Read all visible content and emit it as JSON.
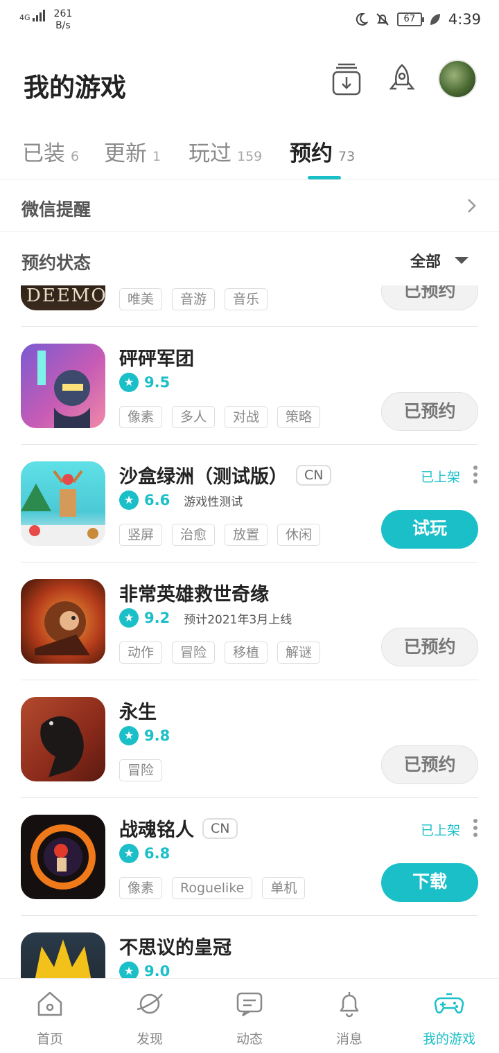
{
  "status_bar": {
    "network": "4G",
    "speed_value": "261",
    "speed_unit": "B/s",
    "battery": "67",
    "time": "4:39"
  },
  "header": {
    "title": "我的游戏"
  },
  "tabs": [
    {
      "label": "已装",
      "count": "6"
    },
    {
      "label": "更新",
      "count": "1"
    },
    {
      "label": "玩过",
      "count": "159"
    },
    {
      "label": "预约",
      "count": "73"
    }
  ],
  "wechat_reminder": {
    "label": "微信提醒"
  },
  "reservation_status": {
    "label": "预约状态",
    "filter": "全部"
  },
  "games": [
    {
      "name": "",
      "tags": [
        "唯美",
        "音游",
        "音乐"
      ],
      "button": "已预约",
      "icon_text": "DEEMO"
    },
    {
      "name": "砰砰军团",
      "rating": "9.5",
      "tags": [
        "像素",
        "多人",
        "对战",
        "策略"
      ],
      "button": "已预约"
    },
    {
      "name": "沙盒绿洲（测试版）",
      "badge": "CN",
      "rating": "6.6",
      "status": "游戏性测试",
      "launched": "已上架",
      "tags": [
        "竖屏",
        "治愈",
        "放置",
        "休闲"
      ],
      "button": "试玩"
    },
    {
      "name": "非常英雄救世奇缘",
      "rating": "9.2",
      "status": "预计2021年3月上线",
      "tags": [
        "动作",
        "冒险",
        "移植",
        "解谜"
      ],
      "button": "已预约"
    },
    {
      "name": "永生",
      "rating": "9.8",
      "tags": [
        "冒险"
      ],
      "button": "已预约"
    },
    {
      "name": "战魂铭人",
      "badge": "CN",
      "rating": "6.8",
      "launched": "已上架",
      "tags": [
        "像素",
        "Roguelike",
        "单机"
      ],
      "button": "下载"
    },
    {
      "name": "不思议的皇冠",
      "rating": "9.0",
      "tags": []
    }
  ],
  "bottom_nav": [
    {
      "label": "首页",
      "icon": "home-icon"
    },
    {
      "label": "发现",
      "icon": "planet-icon"
    },
    {
      "label": "动态",
      "icon": "chat-icon"
    },
    {
      "label": "消息",
      "icon": "bell-icon"
    },
    {
      "label": "我的游戏",
      "icon": "gamepad-icon"
    }
  ],
  "colors": {
    "accent": "#1bbfc8"
  }
}
